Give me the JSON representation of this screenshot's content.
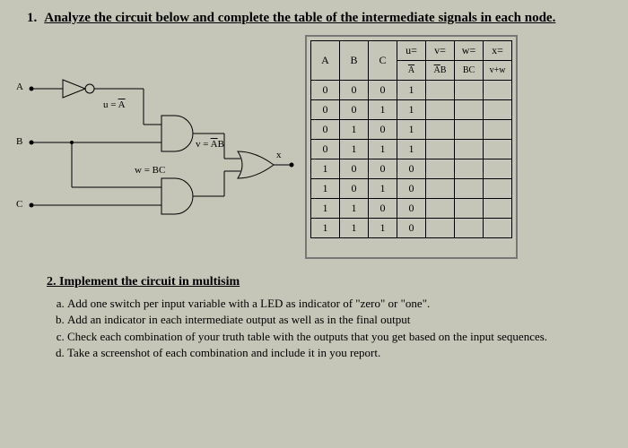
{
  "q1": {
    "number": "1.",
    "text": "Analyze the circuit below and complete the table of the intermediate signals in each node."
  },
  "circuit": {
    "inputs": {
      "a": "A",
      "b": "B",
      "c": "C"
    },
    "labels": {
      "u": "u = A̅",
      "v": "v = A̅B",
      "w": "w = BC",
      "x": "x"
    }
  },
  "table": {
    "headers_row1": [
      "A",
      "B",
      "C",
      "u=",
      "v=",
      "w=",
      "x="
    ],
    "headers_row2": [
      "",
      "",
      "",
      "A̅",
      "A̅B",
      "BC",
      "v+w"
    ],
    "rows": [
      {
        "abc": [
          "0",
          "0",
          "0"
        ],
        "u": "1"
      },
      {
        "abc": [
          "0",
          "0",
          "1"
        ],
        "u": "1"
      },
      {
        "abc": [
          "0",
          "1",
          "0"
        ],
        "u": "1"
      },
      {
        "abc": [
          "0",
          "1",
          "1"
        ],
        "u": "1"
      },
      {
        "abc": [
          "1",
          "0",
          "0"
        ],
        "u": "0"
      },
      {
        "abc": [
          "1",
          "0",
          "1"
        ],
        "u": "0"
      },
      {
        "abc": [
          "1",
          "1",
          "0"
        ],
        "u": "0"
      },
      {
        "abc": [
          "1",
          "1",
          "1"
        ],
        "u": "0"
      }
    ]
  },
  "q2": {
    "number": "2.",
    "text": "Implement the circuit in multisim",
    "items": [
      "Add one switch per input variable with a LED as indicator of \"zero\" or \"one\".",
      "Add an indicator in each intermediate output as well as in the final output",
      "Check each combination of your truth table with the outputs that you get based on the input sequences.",
      "Take a screenshot of each combination and include it in you report."
    ]
  }
}
